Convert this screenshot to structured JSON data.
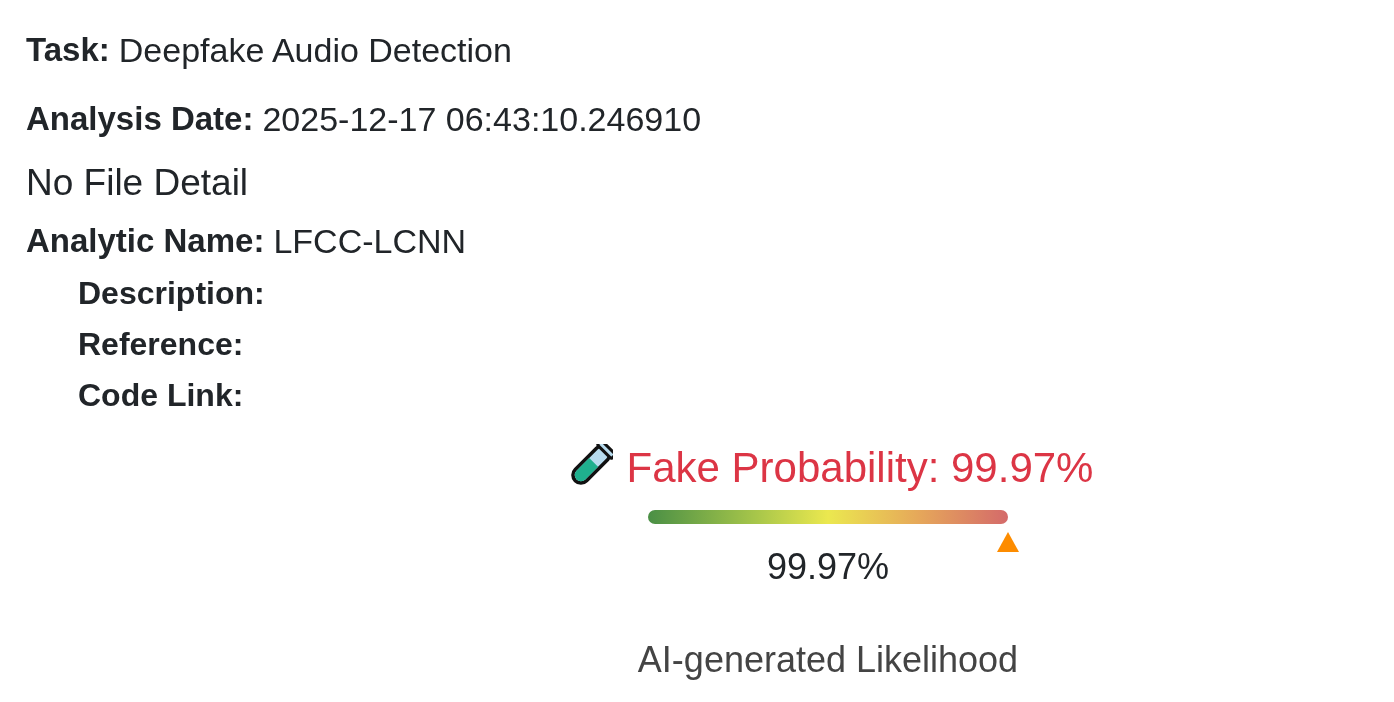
{
  "report": {
    "fields": [
      {
        "label": "Task:",
        "value": "Deepfake Audio Detection"
      },
      {
        "label": "Analysis Date:",
        "value": "2025-12-17 06:43:10.246910"
      }
    ],
    "file_detail": "No File Detail",
    "analytic": {
      "label": "Analytic Name:",
      "value": "LFCC-LCNN",
      "details": [
        {
          "label": "Description:"
        },
        {
          "label": "Reference:"
        },
        {
          "label": "Code Link:"
        }
      ]
    }
  },
  "gauge": {
    "title": "Fake Probability: 99.97%",
    "level": 0.9997,
    "reading": "99.97%",
    "caption": "AI-generated Likelihood"
  }
}
